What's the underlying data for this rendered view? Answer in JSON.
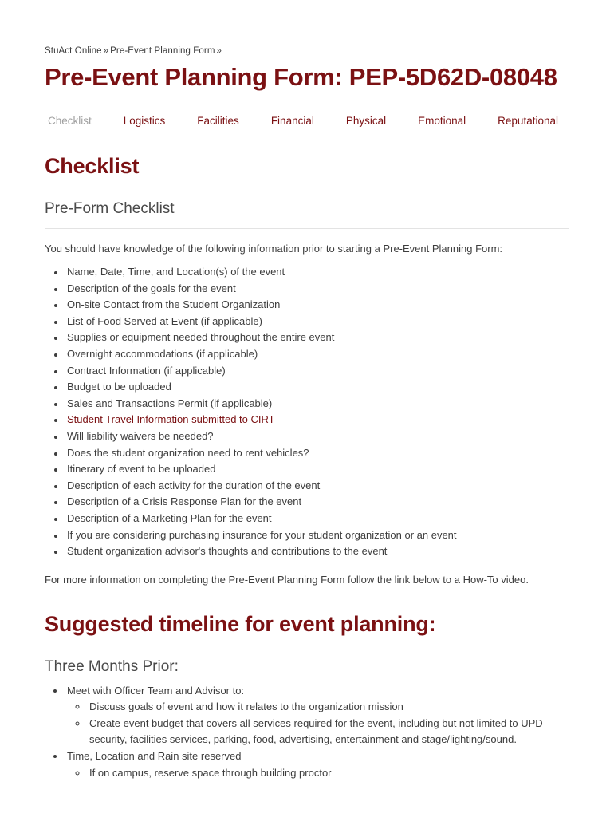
{
  "breadcrumb": {
    "items": [
      {
        "label": "StuAct Online"
      },
      {
        "label": "Pre-Event Planning Form"
      }
    ],
    "separator": "»"
  },
  "header": {
    "title": "Pre-Event Planning Form: PEP-5D62D-08048"
  },
  "tabs": [
    {
      "label": "Checklist",
      "active": true
    },
    {
      "label": "Logistics",
      "active": false
    },
    {
      "label": "Facilities",
      "active": false
    },
    {
      "label": "Financial",
      "active": false
    },
    {
      "label": "Physical",
      "active": false
    },
    {
      "label": "Emotional",
      "active": false
    },
    {
      "label": "Reputational",
      "active": false
    }
  ],
  "main": {
    "section_title": "Checklist",
    "subsection_title": "Pre-Form Checklist",
    "intro_text": "You should have knowledge of the following information prior to starting a Pre-Event Planning Form:",
    "checklist_items": [
      {
        "text": "Name, Date, Time, and Location(s) of the event",
        "is_link": false
      },
      {
        "text": "Description of the goals for the event",
        "is_link": false
      },
      {
        "text": "On-site Contact from the Student Organization",
        "is_link": false
      },
      {
        "text": "List of Food Served at Event (if applicable)",
        "is_link": false
      },
      {
        "text": "Supplies or equipment needed throughout the entire event",
        "is_link": false
      },
      {
        "text": "Overnight accommodations (if applicable)",
        "is_link": false
      },
      {
        "text": "Contract Information (if applicable)",
        "is_link": false
      },
      {
        "text": "Budget to be uploaded",
        "is_link": false
      },
      {
        "text": "Sales and Transactions Permit (if applicable)",
        "is_link": false
      },
      {
        "text": "Student Travel Information submitted to CIRT",
        "is_link": true
      },
      {
        "text": "Will liability waivers be needed?",
        "is_link": false
      },
      {
        "text": "Does the student organization need to rent vehicles?",
        "is_link": false
      },
      {
        "text": "Itinerary of event to be uploaded",
        "is_link": false
      },
      {
        "text": "Description of each activity for the duration of the event",
        "is_link": false
      },
      {
        "text": "Description of a Crisis Response Plan for the event",
        "is_link": false
      },
      {
        "text": "Description of a Marketing Plan for the event",
        "is_link": false
      },
      {
        "text": "If you are considering purchasing insurance for your student organization or an event",
        "is_link": false
      },
      {
        "text": "Student organization advisor's thoughts and contributions to the event",
        "is_link": false
      }
    ],
    "more_info_text": "For more information on completing the Pre-Event Planning Form follow the link below to a How-To video.",
    "timeline_title": "Suggested timeline for event planning:",
    "timeline_subtitle": "Three Months Prior:",
    "timeline_items": [
      {
        "text": "Meet with Officer Team and Advisor to:",
        "children": [
          {
            "text": "Discuss goals of event and how it relates to the organization mission"
          },
          {
            "text": "Create event budget that covers all services required for the event, including but not limited to UPD security, facilities services, parking, food, advertising, entertainment and stage/lighting/sound."
          }
        ]
      },
      {
        "text": "Time, Location and Rain site reserved",
        "children": [
          {
            "text": "If on campus, reserve space through building proctor"
          }
        ]
      }
    ]
  },
  "colors": {
    "brand_maroon": "#7b1113",
    "body_text": "#3d3d3d",
    "muted_tab": "#a0a0a0",
    "rule": "#e3e3e3",
    "background": "#ffffff"
  }
}
